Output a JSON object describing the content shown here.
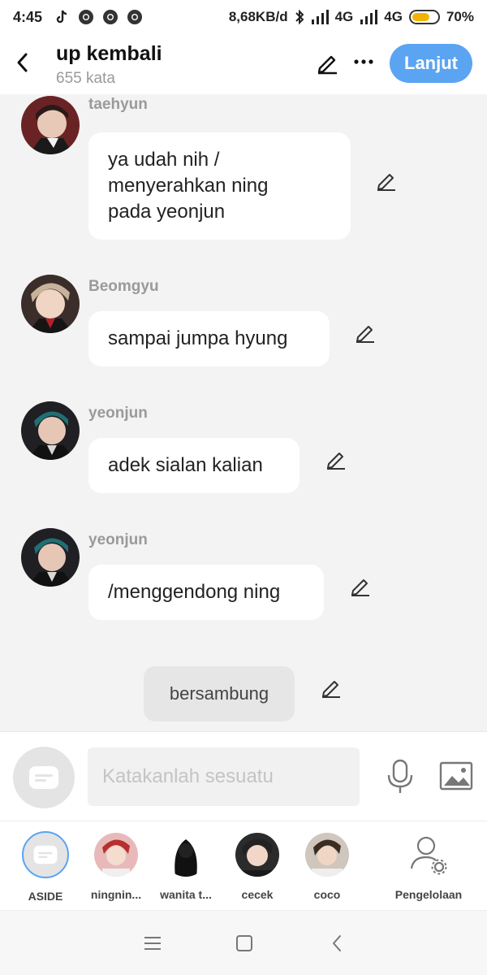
{
  "status_bar": {
    "time": "4:45",
    "network_speed": "8,68KB/d",
    "network1": "4G",
    "network2": "4G",
    "battery_pct": "70%",
    "battery_level": 0.7
  },
  "header": {
    "title": "up kembali",
    "word_count": "655 kata",
    "next_label": "Lanjut"
  },
  "messages": [
    {
      "sender": "taehyun",
      "text": "ya udah nih /\nmenyerahkan ning\npada yeonjun"
    },
    {
      "sender": "Beomgyu",
      "text": "sampai jumpa hyung"
    },
    {
      "sender": "yeonjun",
      "text": "adek sialan kalian"
    },
    {
      "sender": "yeonjun",
      "text": "/menggendong ning"
    }
  ],
  "narration": {
    "text": "bersambung"
  },
  "input": {
    "placeholder": "Katakanlah sesuatu"
  },
  "characters": [
    {
      "name": "ASIDE"
    },
    {
      "name": "ningnin..."
    },
    {
      "name": "wanita t..."
    },
    {
      "name": "cecek"
    },
    {
      "name": "coco"
    }
  ],
  "manage": {
    "label": "Pengelolaan"
  },
  "colors": {
    "accent": "#5aa4f2",
    "background": "#f3f3f3",
    "bubble": "#ffffff"
  }
}
